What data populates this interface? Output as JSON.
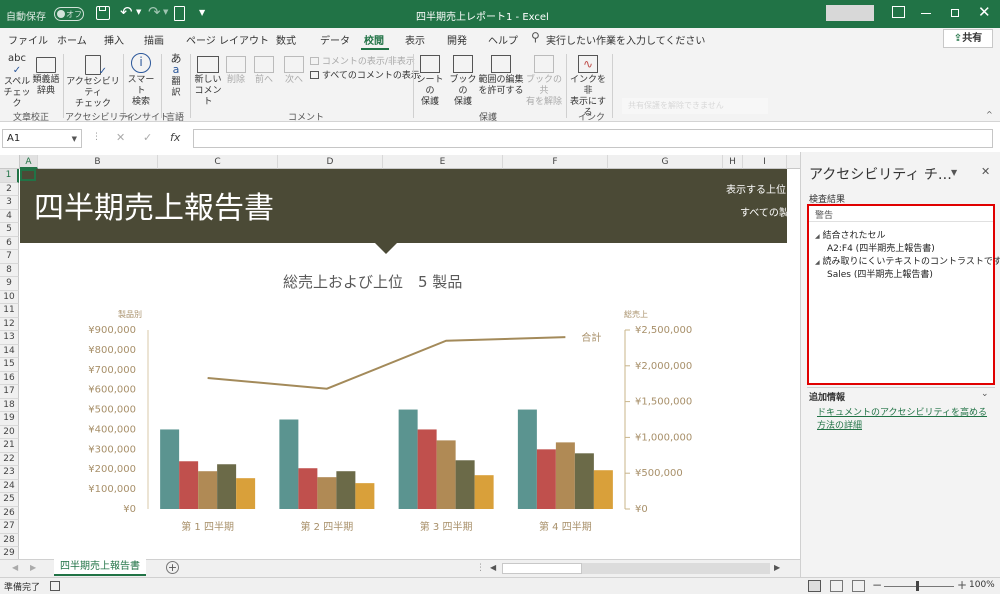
{
  "titlebar": {
    "autosave_label": "自動保存",
    "autosave_state": "オフ",
    "title": "四半期売上レポート1  -  Excel"
  },
  "tabs": [
    "ファイル",
    "ホーム",
    "挿入",
    "描画",
    "ページ レイアウト",
    "数式",
    "データ",
    "校閲",
    "表示",
    "開発",
    "ヘルプ"
  ],
  "active_tab": "校閲",
  "tell_me": "実行したい作業を入力してください",
  "share_label": "共有",
  "ribbon": {
    "spell": [
      "スペル",
      "チェック"
    ],
    "thesaurus": [
      "類義語",
      "辞典"
    ],
    "a11y_check": [
      "アクセシビリティ",
      "チェック"
    ],
    "smart_lookup": [
      "スマート",
      "検索"
    ],
    "translate": [
      "翻",
      "訳"
    ],
    "new_comment": [
      "新しい",
      "コメント"
    ],
    "delete": "削除",
    "prev": "前へ",
    "next": "次へ",
    "show_hide_comment": "コメントの表示/非表示",
    "show_all_comments": "すべてのコメントの表示",
    "protect_sheet": [
      "シートの",
      "保護"
    ],
    "protect_book": [
      "ブックの",
      "保護"
    ],
    "allow_edit": [
      "範囲の編集",
      "を許可する"
    ],
    "unshare_book": [
      "ブックの共",
      "有を解除"
    ],
    "hide_ink": [
      "インクを非",
      "表示にする"
    ],
    "ghost": "共有保護を解除できません",
    "groups": {
      "proofing": "文章校正",
      "accessibility": "アクセシビリティ",
      "insights": "インサイト",
      "language": "言語",
      "comments": "コメント",
      "protect": "保護",
      "ink": "インク"
    }
  },
  "formula": {
    "name_box": "A1",
    "fx": "fx",
    "value": ""
  },
  "columns": [
    "A",
    "B",
    "C",
    "D",
    "E",
    "F",
    "G",
    "H",
    "I"
  ],
  "rows": [
    "1",
    "2",
    "3",
    "4",
    "5",
    "6",
    "7",
    "8",
    "9",
    "10",
    "11",
    "12",
    "13",
    "14",
    "15",
    "16",
    "17",
    "18",
    "19",
    "20",
    "21",
    "22",
    "23",
    "24",
    "25",
    "26",
    "27",
    "28",
    "29"
  ],
  "banner": {
    "title": "四半期売上報告書",
    "right1": "表示する上位",
    "right2": "すべての製"
  },
  "chart_data": {
    "type": "bar",
    "title": "総売上および上位　5 製品",
    "left_axis_title": "製品別",
    "right_axis_title": "総売上",
    "categories": [
      "第 1 四半期",
      "第 2 四半期",
      "第 3 四半期",
      "第 4 四半期"
    ],
    "ylim": [
      0,
      900000
    ],
    "y2lim": [
      0,
      2500000
    ],
    "yticks": [
      "¥0",
      "¥100,000",
      "¥200,000",
      "¥300,000",
      "¥400,000",
      "¥500,000",
      "¥600,000",
      "¥700,000",
      "¥800,000",
      "¥900,000"
    ],
    "y2ticks": [
      "¥0",
      "¥500,000",
      "¥1,000,000",
      "¥1,500,000",
      "¥2,000,000",
      "¥2,500,000"
    ],
    "series": [
      {
        "color": "#5b9490",
        "values": [
          400000,
          450000,
          500000,
          500000
        ]
      },
      {
        "color": "#c0504d",
        "values": [
          240000,
          205000,
          400000,
          300000
        ]
      },
      {
        "color": "#b08a55",
        "values": [
          190000,
          160000,
          345000,
          335000
        ]
      },
      {
        "color": "#6b6a48",
        "values": [
          225000,
          190000,
          245000,
          280000
        ]
      },
      {
        "color": "#d9a03a",
        "values": [
          155000,
          130000,
          170000,
          195000
        ]
      }
    ],
    "line": {
      "name": "合計",
      "color": "#a38a5a",
      "values": [
        1830000,
        1680000,
        2350000,
        2400000
      ]
    }
  },
  "sheet_tab": "四半期売上報告書",
  "status": {
    "ready": "準備完了",
    "zoom": "100%"
  },
  "pane": {
    "title": "アクセシビリティ チ…",
    "results_label": "検査結果",
    "warning_header": "警告",
    "items": [
      {
        "category": "結合されたセル",
        "detail": "A2:F4 (四半期売上報告書)"
      },
      {
        "category": "読み取りにくいテキストのコントラストです",
        "detail": "Sales (四半期売上報告書)"
      }
    ],
    "more_info_label": "追加情報",
    "link_text": "ドキュメントのアクセシビリティを高める方法の詳細"
  },
  "colors": {
    "excel_green": "#217346",
    "banner": "#4b4a36",
    "warning_border": "#e00000"
  }
}
